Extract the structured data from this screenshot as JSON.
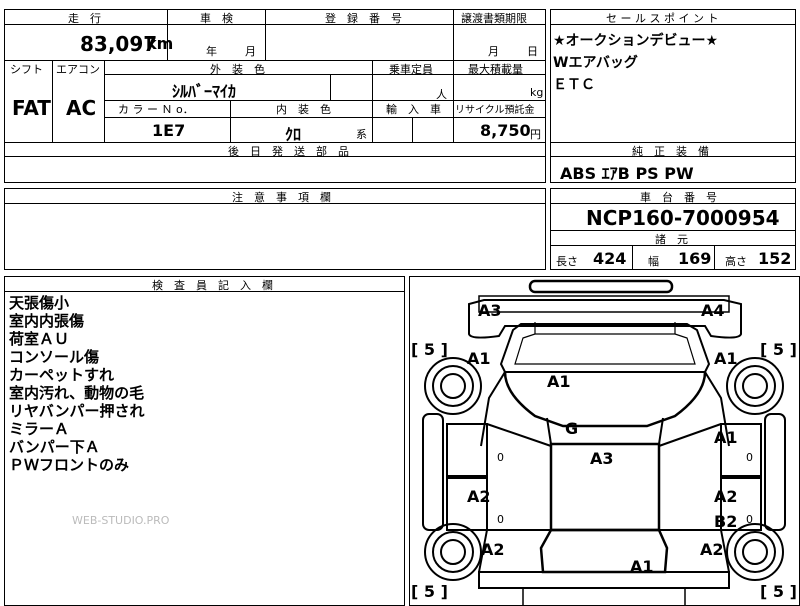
{
  "top_left": {
    "mileage_label": "走　行",
    "mileage_value": "83,097",
    "mileage_unit": "km",
    "inspection_label": "車　検",
    "inspection_year": "年",
    "inspection_month": "月",
    "registration_label": "登　録　番　号",
    "transfer_label": "譲渡書類期限",
    "transfer_month": "月",
    "transfer_day": "日",
    "shift_label": "シフト",
    "shift_value": "FAT",
    "ac_label": "エアコン",
    "ac_value": "AC",
    "exterior_label": "外　装　色",
    "exterior_value": "ｼﾙﾊﾞｰﾏｲｶ",
    "capacity_label": "乗車定員",
    "capacity_unit": "人",
    "load_label": "最大積載量",
    "load_unit": "kg",
    "color_no_label": "カ ラ ー Ｎ o．",
    "color_no_value": "1E7",
    "interior_label": "内　装　色",
    "interior_value": "ｸﾛ",
    "interior_suffix": "系",
    "import_label": "輸　入　車",
    "recycle_label": "リサイクル預託金",
    "recycle_value": "8,750",
    "recycle_unit": "円",
    "later_parts_label": "後　日　発　送　部　品"
  },
  "sales_points": {
    "label": "セ ー ル ス ポ イ ン ト",
    "lines": [
      "★オークションデビュー★",
      "Wエアバッグ",
      "ＥＴＣ"
    ]
  },
  "equipment": {
    "label": "純　正　装　備",
    "value": "ABS  ｴｱB  PS  PW"
  },
  "notes": {
    "label": "注　意　事　項　欄"
  },
  "chassis": {
    "label": "車　台　番　号",
    "value": "NCP160-7000954",
    "specs_label": "諸　元",
    "length_label": "長さ",
    "length_value": "424",
    "width_label": "幅",
    "width_value": "169",
    "height_label": "高さ",
    "height_value": "152"
  },
  "inspector": {
    "label": "検　査　員　記　入　欄",
    "lines": [
      "天張傷小",
      "室内内張傷",
      "荷室ＡＵ",
      "コンソール傷",
      "カーペットすれ",
      "室内汚れ、動物の毛",
      "リヤバンパー押され",
      "ミラーＡ",
      "バンパー下Ａ",
      "ＰＷフロントのみ"
    ],
    "watermark": "WEB-STUDIO.PRO"
  },
  "diagram": {
    "marks": {
      "a3_tl": "A3",
      "a4_tr": "A4",
      "a1_fl": "A1",
      "a1_fr": "A1",
      "a1_hood": "A1",
      "g_glass": "G",
      "a3_roof": "A3",
      "a1_r_door": "A1",
      "a2_l_door": "A2",
      "a2_r_door": "A2",
      "b2_r_door": "B2",
      "a2_rl": "A2",
      "a2_rr": "A2",
      "a1_trunk": "A1"
    },
    "tires": {
      "fl": "5",
      "fr": "5",
      "rl": "5",
      "rr": "5"
    },
    "zero": "0"
  }
}
